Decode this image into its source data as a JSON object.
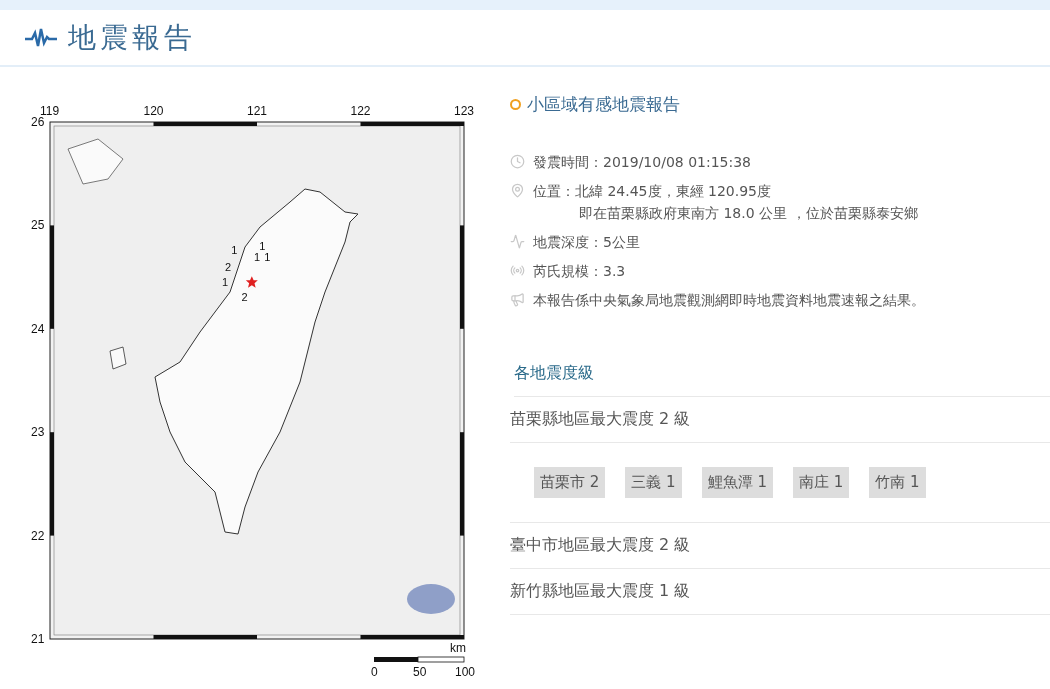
{
  "header": {
    "title": "地震報告"
  },
  "map": {
    "lon_labels": [
      "119",
      "120",
      "121",
      "122",
      "123"
    ],
    "lat_labels": [
      "26",
      "25",
      "24",
      "23",
      "22",
      "21"
    ],
    "intensity_marks": [
      "1",
      "1",
      "1",
      "1",
      "2",
      "1",
      "2"
    ],
    "scale": {
      "unit": "km",
      "ticks": [
        "0",
        "50",
        "100"
      ]
    }
  },
  "report": {
    "type": "小區域有感地震報告",
    "details": [
      {
        "kind": "time",
        "lines": [
          "發震時間：2019/10/08 01:15:38"
        ]
      },
      {
        "kind": "location",
        "lines": [
          "位置：北緯 24.45度，東經 120.95度",
          "即在苗栗縣政府東南方 18.0 公里 ，位於苗栗縣泰安鄉"
        ]
      },
      {
        "kind": "depth",
        "lines": [
          "地震深度：5公里"
        ]
      },
      {
        "kind": "magnitude",
        "lines": [
          "芮氏規模：3.3"
        ]
      },
      {
        "kind": "note",
        "lines": [
          "本報告係中央氣象局地震觀測網即時地震資料地震速報之結果。"
        ]
      }
    ]
  },
  "intensity": {
    "title": "各地震度級",
    "regions": [
      {
        "title": "苗栗縣地區最大震度 2 級",
        "stations": [
          "苗栗市 2",
          "三義 1",
          "鯉魚潭 1",
          "南庄 1",
          "竹南 1"
        ]
      },
      {
        "title": "臺中市地區最大震度 2 級"
      },
      {
        "title": "新竹縣地區最大震度 1 級"
      }
    ]
  }
}
